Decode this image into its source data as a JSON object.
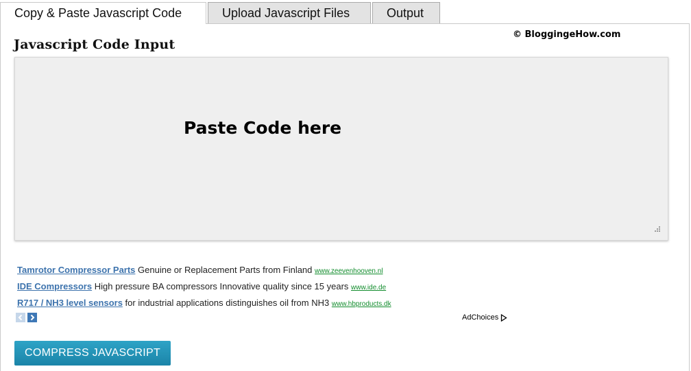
{
  "tabs": [
    {
      "label": "Copy & Paste Javascript Code",
      "active": true
    },
    {
      "label": "Upload Javascript Files",
      "active": false
    },
    {
      "label": "Output",
      "active": false
    }
  ],
  "copyright": "© BloggingeHow.com",
  "section_title": "Javascript Code Input",
  "code_input": {
    "value": "",
    "hint": "Paste Code here"
  },
  "ads": [
    {
      "title": "Tamrotor Compressor Parts",
      "text": "Genuine or Replacement Parts from Finland",
      "url": "www.zeevenhooven.nl"
    },
    {
      "title": "IDE Compressors",
      "text": "High pressure BA compressors Innovative quality since 15 years",
      "url": "www.ide.de"
    },
    {
      "title": "R717 / NH3 level sensors",
      "text": "for industrial applications distinguishes oil from NH3",
      "url": "www.hbproducts.dk"
    }
  ],
  "adchoices_label": "AdChoices",
  "compress_button_label": "COMPRESS JAVASCRIPT",
  "colors": {
    "tab_inactive_bg": "#e3e3e3",
    "code_area_bg": "#efefef",
    "ad_link": "#3d73ad",
    "ad_url": "#118c2c",
    "button_bg": "#1b84a8"
  }
}
